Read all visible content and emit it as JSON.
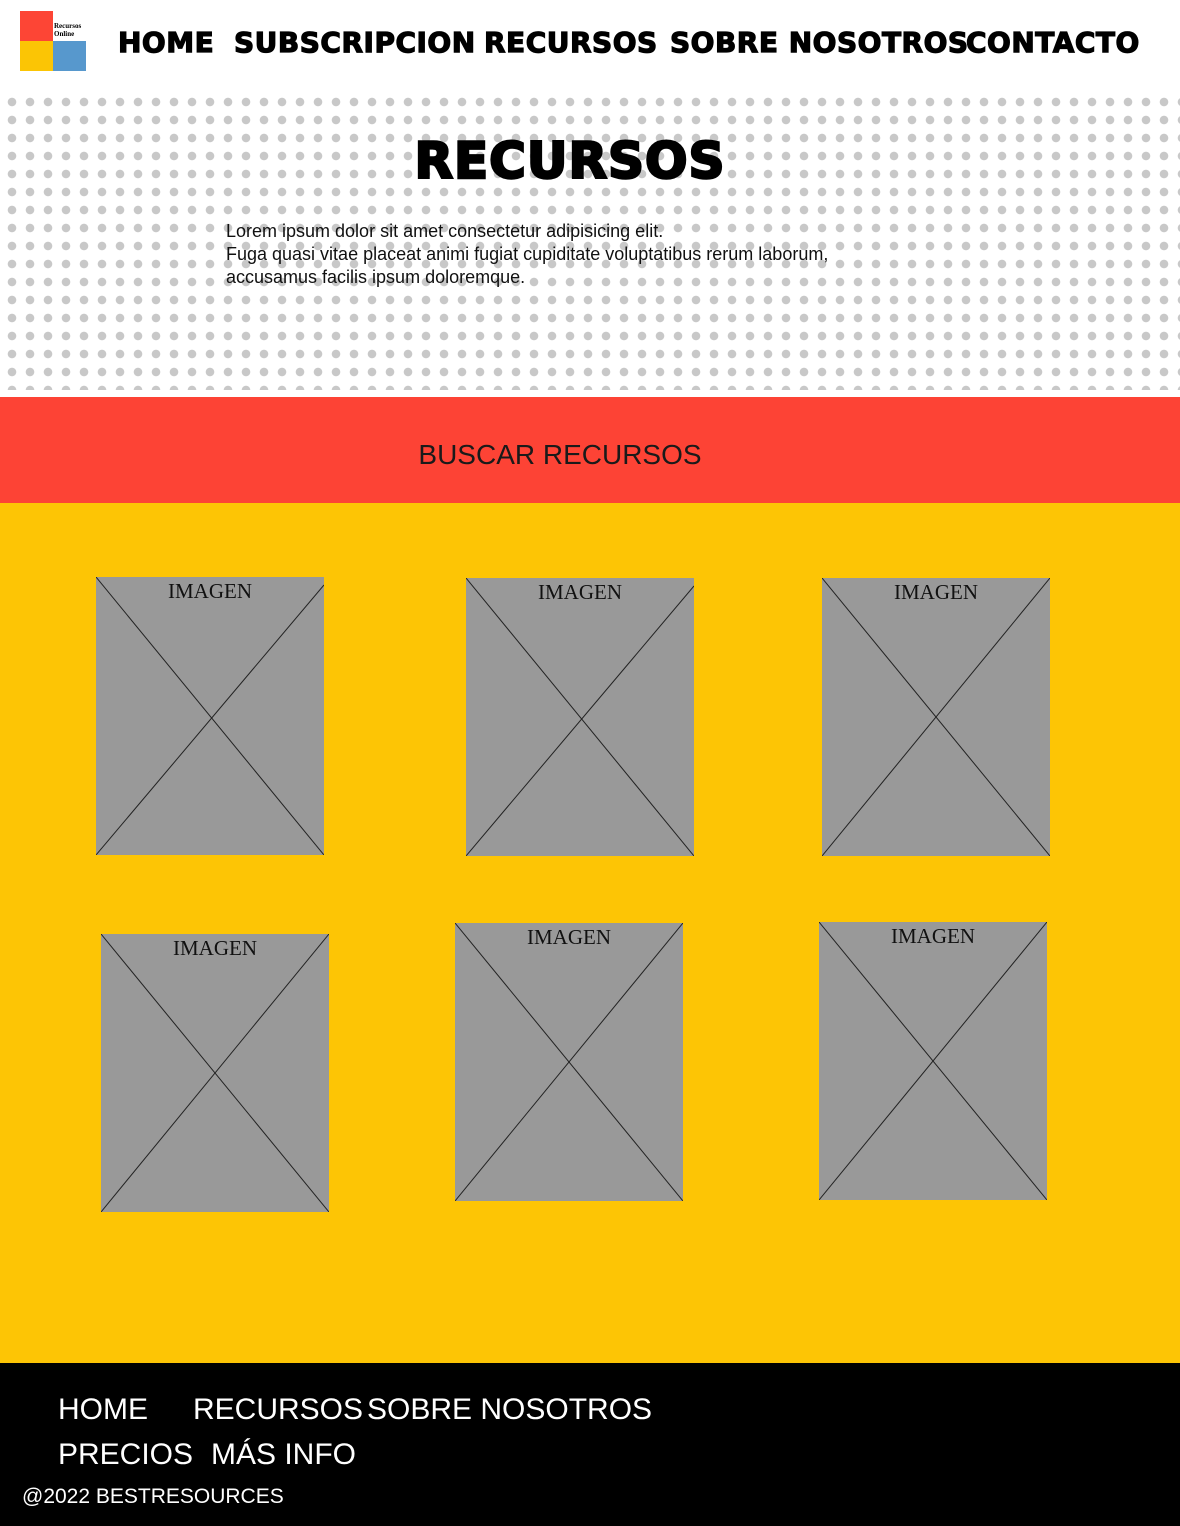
{
  "header": {
    "logo": {
      "text_line1": "Recursos",
      "text_line2": "Online"
    },
    "nav": [
      {
        "label": "HOME"
      },
      {
        "label": "SUBSCRIPCION"
      },
      {
        "label": "RECURSOS"
      },
      {
        "label": "SOBRE NOSOTROS"
      },
      {
        "label": "CONTACTO"
      }
    ]
  },
  "hero": {
    "title": "RECURSOS",
    "lines": [
      "Lorem ipsum dolor sit amet consectetur adipisicing elit.",
      "Fuga quasi vitae placeat animi fugiat cupiditate voluptatibus rerum laborum,",
      "accusamus facilis ipsum doloremque."
    ]
  },
  "search": {
    "label": "BUSCAR RECURSOS"
  },
  "cards": [
    {
      "label": "IMAGEN"
    },
    {
      "label": "IMAGEN"
    },
    {
      "label": "IMAGEN"
    },
    {
      "label": "IMAGEN"
    },
    {
      "label": "IMAGEN"
    },
    {
      "label": "IMAGEN"
    }
  ],
  "footer": {
    "links": [
      {
        "label": "HOME"
      },
      {
        "label": "RECURSOS"
      },
      {
        "label": "SOBRE NOSOTROS"
      },
      {
        "label": "PRECIOS"
      },
      {
        "label": "MÁS INFO"
      }
    ],
    "copyright": "@2022 BESTRESOURCES"
  },
  "colors": {
    "red": "#fd4335",
    "yellow": "#fdc505",
    "blue": "#5798cd",
    "placeholder_gray": "#999999",
    "footer_bg": "#000000"
  }
}
